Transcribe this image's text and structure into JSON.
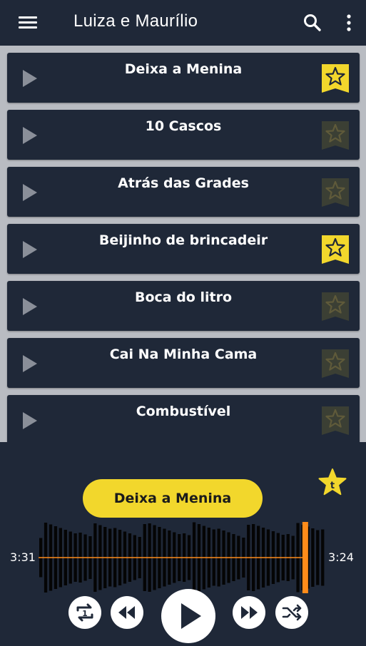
{
  "app": {
    "title": "Luiza e Maurílio"
  },
  "colors": {
    "background": "#1f2838",
    "accent": "#f2d72c",
    "progress": "#ff8c1a",
    "favorite_inactive": "#3b3f34"
  },
  "toolbar_icons": [
    "menu-icon",
    "search-icon",
    "more-vertical-icon"
  ],
  "songs": [
    {
      "title": "Deixa a Menina",
      "favorite": true
    },
    {
      "title": "10 Cascos",
      "favorite": false
    },
    {
      "title": "Atrás das Grades",
      "favorite": false
    },
    {
      "title": "Beijinho de brincadeir",
      "favorite": true
    },
    {
      "title": "Boca do litro",
      "favorite": false
    },
    {
      "title": "Cai Na Minha Cama",
      "favorite": false
    },
    {
      "title": "Combustível",
      "favorite": false
    }
  ],
  "player": {
    "now_playing": "Deixa a Menina",
    "elapsed": "3:31",
    "remaining": "3:24",
    "progress_fraction": 0.93,
    "controls": [
      "repeat-one-icon",
      "rewind-icon",
      "play-icon",
      "fast-forward-icon",
      "shuffle-icon"
    ]
  }
}
